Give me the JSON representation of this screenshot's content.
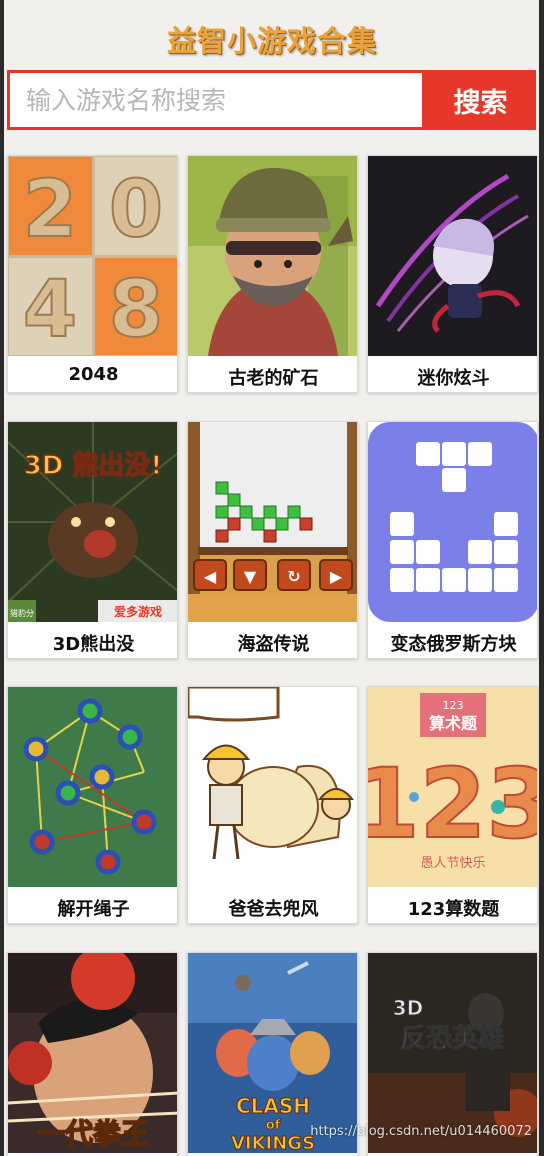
{
  "header": {
    "title": "益智小游戏合集"
  },
  "search": {
    "placeholder": "输入游戏名称搜索",
    "button_label": "搜索"
  },
  "games": [
    {
      "name": "2048",
      "tiles": [
        "2",
        "0",
        "4",
        "8"
      ]
    },
    {
      "name": "古老的矿石"
    },
    {
      "name": "迷你炫斗"
    },
    {
      "name": "3D熊出没",
      "art_text": "3D 熊出没!",
      "badge": "爱多游戏",
      "corner": "猎豹分"
    },
    {
      "name": "海盗传说"
    },
    {
      "name": "变态俄罗斯方块"
    },
    {
      "name": "解开绳子"
    },
    {
      "name": "爸爸去兜风"
    },
    {
      "name": "123算数题",
      "art_top": "123",
      "art_sub": "算术题",
      "art_bottom": "愚人节快乐",
      "art_digits": "123"
    },
    {
      "name": "",
      "art_text": "一代拳王"
    },
    {
      "name": "",
      "art_text_1": "CLASH",
      "art_text_2": "of",
      "art_text_3": "VIKINGS"
    },
    {
      "name": "",
      "art_text_1": "3D",
      "art_text_2": "反恐英雄"
    }
  ],
  "watermark": "https://blog.csdn.net/u014460072"
}
